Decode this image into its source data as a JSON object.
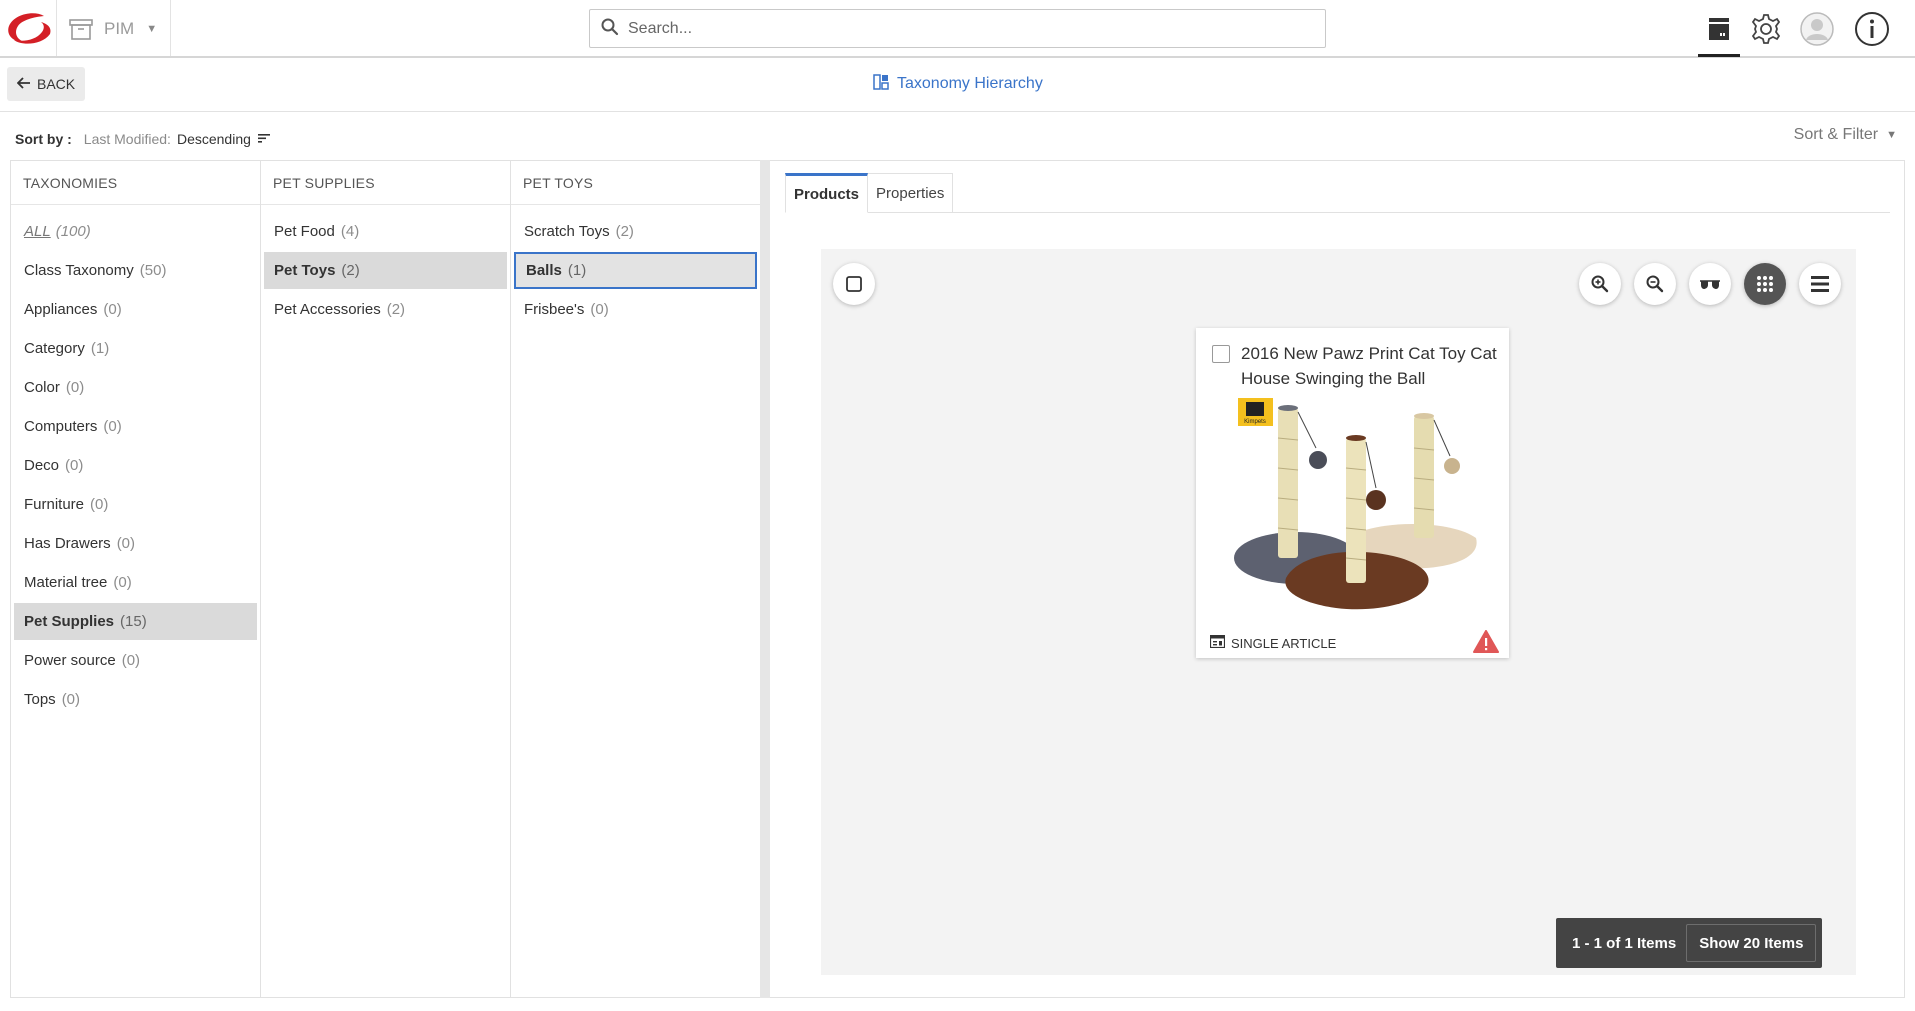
{
  "app": {
    "module_label": "PIM"
  },
  "search": {
    "placeholder": "Search..."
  },
  "header": {
    "back_label": "BACK",
    "title": "Taxonomy Hierarchy"
  },
  "sort": {
    "label": "Sort by :",
    "field": "Last Modified:",
    "direction": "Descending",
    "filter_label": "Sort & Filter"
  },
  "columns": {
    "taxonomies": {
      "header": "TAXONOMIES",
      "items": [
        {
          "name": "ALL",
          "count": "(100)"
        },
        {
          "name": "Class Taxonomy",
          "count": "(50)"
        },
        {
          "name": "Appliances",
          "count": "(0)"
        },
        {
          "name": "Category",
          "count": "(1)"
        },
        {
          "name": "Color",
          "count": "(0)"
        },
        {
          "name": "Computers",
          "count": "(0)"
        },
        {
          "name": "Deco",
          "count": "(0)"
        },
        {
          "name": "Furniture",
          "count": "(0)"
        },
        {
          "name": "Has Drawers",
          "count": "(0)"
        },
        {
          "name": "Material tree",
          "count": "(0)"
        },
        {
          "name": "Pet Supplies",
          "count": "(15)"
        },
        {
          "name": "Power source",
          "count": "(0)"
        },
        {
          "name": "Tops",
          "count": "(0)"
        }
      ]
    },
    "pet_supplies": {
      "header": "PET SUPPLIES",
      "items": [
        {
          "name": "Pet Food",
          "count": "(4)"
        },
        {
          "name": "Pet Toys",
          "count": "(2)"
        },
        {
          "name": "Pet Accessories",
          "count": "(2)"
        }
      ]
    },
    "pet_toys": {
      "header": "PET TOYS",
      "items": [
        {
          "name": "Scratch Toys",
          "count": "(2)"
        },
        {
          "name": "Balls",
          "count": "(1)"
        },
        {
          "name": "Frisbee's",
          "count": "(0)"
        }
      ]
    }
  },
  "tabs": [
    {
      "label": "Products"
    },
    {
      "label": "Properties"
    }
  ],
  "product_card": {
    "title": "2016 New Pawz Print Cat Toy Cat House Swinging the Ball",
    "type_label": "SINGLE ARTICLE",
    "brand_badge": "Kimpets"
  },
  "pager": {
    "range": "1 - 1 of 1 Items",
    "show_label": "Show 20 Items"
  },
  "colors": {
    "accent": "#3a74c9",
    "logo_red": "#d41f26",
    "warning": "#e05757"
  }
}
